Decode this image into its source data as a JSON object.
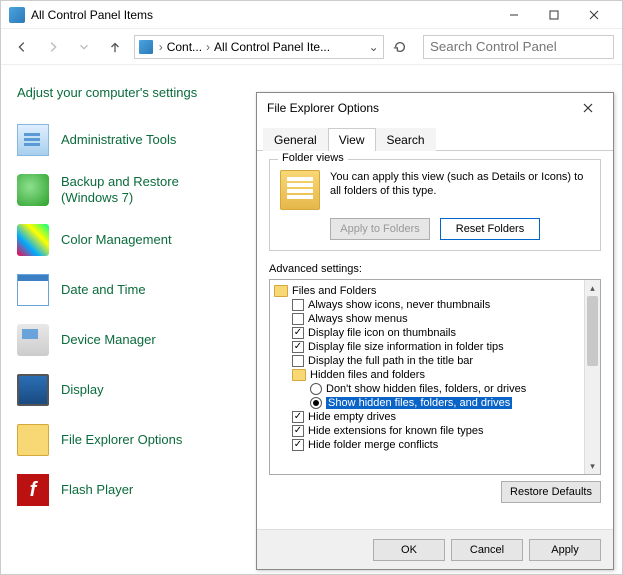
{
  "window": {
    "title": "All Control Panel Items"
  },
  "nav": {
    "crumb1": "Cont...",
    "crumb2": "All Control Panel Ite...",
    "search_placeholder": "Search Control Panel"
  },
  "heading": "Adjust your computer's settings",
  "items": [
    {
      "label": "Administrative Tools"
    },
    {
      "label": "Backup and Restore (Windows 7)"
    },
    {
      "label": "Color Management"
    },
    {
      "label": "Date and Time"
    },
    {
      "label": "Device Manager"
    },
    {
      "label": "Display"
    },
    {
      "label": "File Explorer Options"
    },
    {
      "label": "Flash Player"
    }
  ],
  "dialog": {
    "title": "File Explorer Options",
    "tabs": {
      "general": "General",
      "view": "View",
      "search": "Search"
    },
    "folder_views": {
      "legend": "Folder views",
      "text": "You can apply this view (such as Details or Icons) to all folders of this type.",
      "apply_btn": "Apply to Folders",
      "reset_btn": "Reset Folders"
    },
    "advanced_label": "Advanced settings:",
    "tree": {
      "root": "Files and Folders",
      "n1": "Always show icons, never thumbnails",
      "n2": "Always show menus",
      "n3": "Display file icon on thumbnails",
      "n4": "Display file size information in folder tips",
      "n5": "Display the full path in the title bar",
      "hidden_group": "Hidden files and folders",
      "r1": "Don't show hidden files, folders, or drives",
      "r2": "Show hidden files, folders, and drives",
      "n6": "Hide empty drives",
      "n7": "Hide extensions for known file types",
      "n8": "Hide folder merge conflicts"
    },
    "restore_btn": "Restore Defaults",
    "ok": "OK",
    "cancel": "Cancel",
    "apply": "Apply"
  },
  "flash_letter": "f"
}
